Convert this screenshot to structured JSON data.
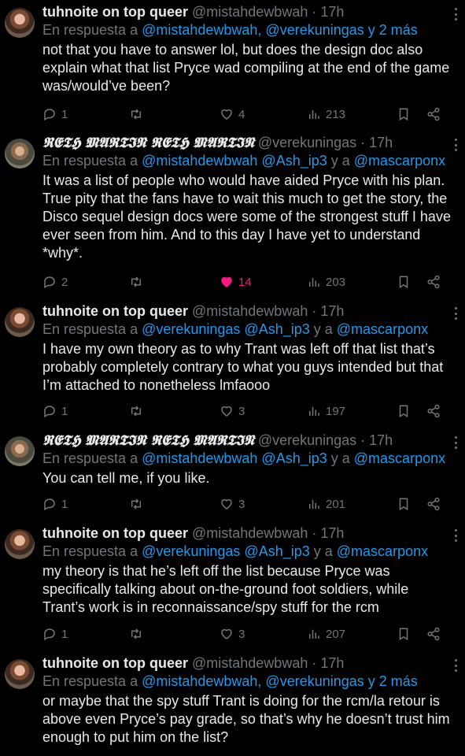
{
  "tweets": [
    {
      "name": "tuhnoite on top queer",
      "handle": "@mistahdewbwah · 17h",
      "reply_prefix": "En respuesta a ",
      "reply_mentions": "@mistahdewbwah, @verekuningas y 2 más",
      "reply_parts": [],
      "text": "not that you have to answer lol, but does the design doc also explain what that list Pryce wad compiling at the end of the game was/would’ve been?",
      "replies": "1",
      "likes": "4",
      "views": "213",
      "liked": false
    },
    {
      "name": "𝕽𝕰𝕿𝕳 𝕸𝕬𝕽𝕿𝕴𝕹 𝕽𝕰𝕿𝕳 𝕸𝕬𝕽𝕿𝕴𝕹",
      "handle": "@verekuningas · 17h",
      "reply_prefix": "En respuesta a ",
      "reply_mentions": "@mistahdewbwah @Ash_ip3",
      "reply_mid": " y a ",
      "reply_last": "@mascarponx",
      "text": "It was a list of people who would have aided Pryce with his plan. True pity that the fans have to wait this much to get the story, the Disco sequel design docs were some of the strongest stuff I have ever seen from him. And to this day I have yet to understand *why*.",
      "replies": "2",
      "likes": "14",
      "views": "203",
      "liked": true
    },
    {
      "name": "tuhnoite on top queer",
      "handle": "@mistahdewbwah · 17h",
      "reply_prefix": "En respuesta a ",
      "reply_mentions": "@verekuningas @Ash_ip3",
      "reply_mid": " y a ",
      "reply_last": "@mascarponx",
      "text": "I have my own theory as to why Trant was left off that list that’s probably completely contrary to what you guys intended but that I’m attached to nonetheless lmfaooo",
      "replies": "1",
      "likes": "3",
      "views": "197",
      "liked": false
    },
    {
      "name": "𝕽𝕰𝕿𝕳 𝕸𝕬𝕽𝕿𝕴𝕹 𝕽𝕰𝕿𝕳 𝕸𝕬𝕽𝕿𝕴𝕹",
      "handle": "@verekuningas · 17h",
      "reply_prefix": "En respuesta a ",
      "reply_mentions": "@mistahdewbwah @Ash_ip3",
      "reply_mid": " y a ",
      "reply_last": "@mascarponx",
      "text": "You can tell me, if you like.",
      "replies": "1",
      "likes": "3",
      "views": "201",
      "liked": false
    },
    {
      "name": "tuhnoite on top queer",
      "handle": "@mistahdewbwah · 17h",
      "reply_prefix": "En respuesta a ",
      "reply_mentions": "@verekuningas @Ash_ip3",
      "reply_mid": " y a ",
      "reply_last": "@mascarponx",
      "text": "my theory is that he’s left off the list because Pryce was specifically talking about on-the-ground foot soldiers, while Trant’s work is in reconnaissance/spy stuff for the rcm",
      "replies": "1",
      "likes": "3",
      "views": "207",
      "liked": false
    },
    {
      "name": "tuhnoite on top queer",
      "handle": "@mistahdewbwah · 17h",
      "reply_prefix": "En respuesta a ",
      "reply_mentions": "@mistahdewbwah, @verekuningas y 2 más",
      "text": "or maybe that the spy stuff Trant is doing for the rcm/la retour is above even Pryce’s pay grade, so that’s why he doesn’t trust him enough to put him on the list?",
      "replies": "",
      "likes": "",
      "views": "",
      "liked": false
    }
  ],
  "colors": {
    "background": "#000000",
    "text": "#e7e9ea",
    "muted": "#71767b",
    "link": "#1d9bf0",
    "like_active": "#f91880"
  },
  "icons": [
    "reply-icon",
    "retweet-icon",
    "heart-icon",
    "views-icon",
    "bookmark-icon",
    "share-icon",
    "more-icon"
  ]
}
